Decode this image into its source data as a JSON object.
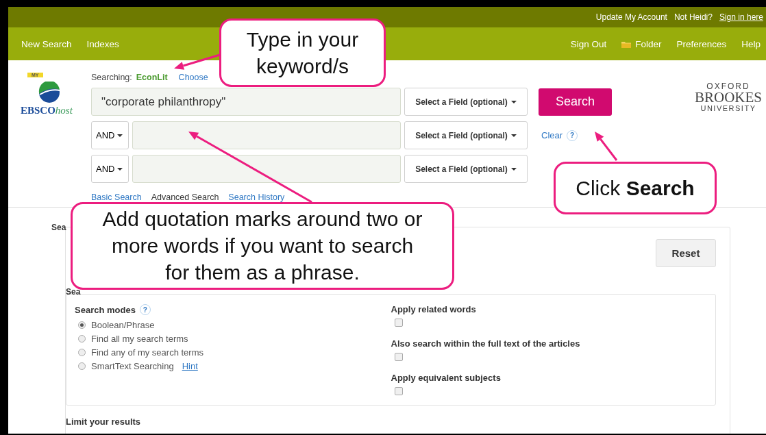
{
  "top_bar": {
    "links": [
      {
        "text": "Update My Account",
        "kind": "plain"
      },
      {
        "text": "Not Heidi?",
        "kind": "plain"
      },
      {
        "text": "Sign in here",
        "kind": "link"
      }
    ]
  },
  "nav": {
    "left_items": [
      "New Search",
      "Indexes"
    ],
    "right_items": [
      {
        "label": "Sign Out",
        "kind": "plain"
      },
      {
        "label": "Folder",
        "kind": "folder"
      },
      {
        "label": "Preferences",
        "kind": "plain"
      },
      {
        "label": "Help",
        "kind": "plain"
      }
    ]
  },
  "logo": {
    "badge": "MY",
    "name": "EBSCO",
    "suffix": "host"
  },
  "searching": {
    "label": "Searching:",
    "database": "EconLit",
    "choose": "Choose"
  },
  "rows": [
    {
      "value": "\"corporate philanthropy\"",
      "field": "Select a Field (optional)"
    },
    {
      "operator": "AND",
      "field": "Select a Field (optional)"
    },
    {
      "operator": "AND",
      "field": "Select a Field (optional)"
    }
  ],
  "search_button": "Search",
  "clear": "Clear",
  "help_glyph": "?",
  "institution": {
    "lines": [
      "OXFORD",
      "BROOKES",
      "UNIVERSITY"
    ]
  },
  "search_links": [
    {
      "label": "Basic Search",
      "selected": false
    },
    {
      "label": "Advanced Search",
      "selected": true
    },
    {
      "label": "Search History",
      "selected": false
    }
  ],
  "options": {
    "heading": "Sea",
    "reset": "Reset",
    "section_heading": "Sea",
    "modes_title": "Search modes",
    "modes": [
      {
        "label": "Boolean/Phrase",
        "selected": true
      },
      {
        "label": "Find all my search terms",
        "selected": false
      },
      {
        "label": "Find any of my search terms",
        "selected": false
      },
      {
        "label": "SmartText Searching",
        "selected": false,
        "hint": "Hint"
      }
    ],
    "expanders": [
      {
        "label": "Apply related words",
        "checked": false
      },
      {
        "label": "Also search within the full text of the articles",
        "checked": false
      },
      {
        "label": "Apply equivalent subjects",
        "checked": false
      }
    ]
  },
  "limit": {
    "heading": "Limit your results"
  },
  "callouts": [
    {
      "text": "Type in your keyword/s"
    },
    {
      "text": "Add quotation marks around two or more words if you want to search for them as a phrase."
    },
    {
      "text": "Click **Search**"
    }
  ]
}
